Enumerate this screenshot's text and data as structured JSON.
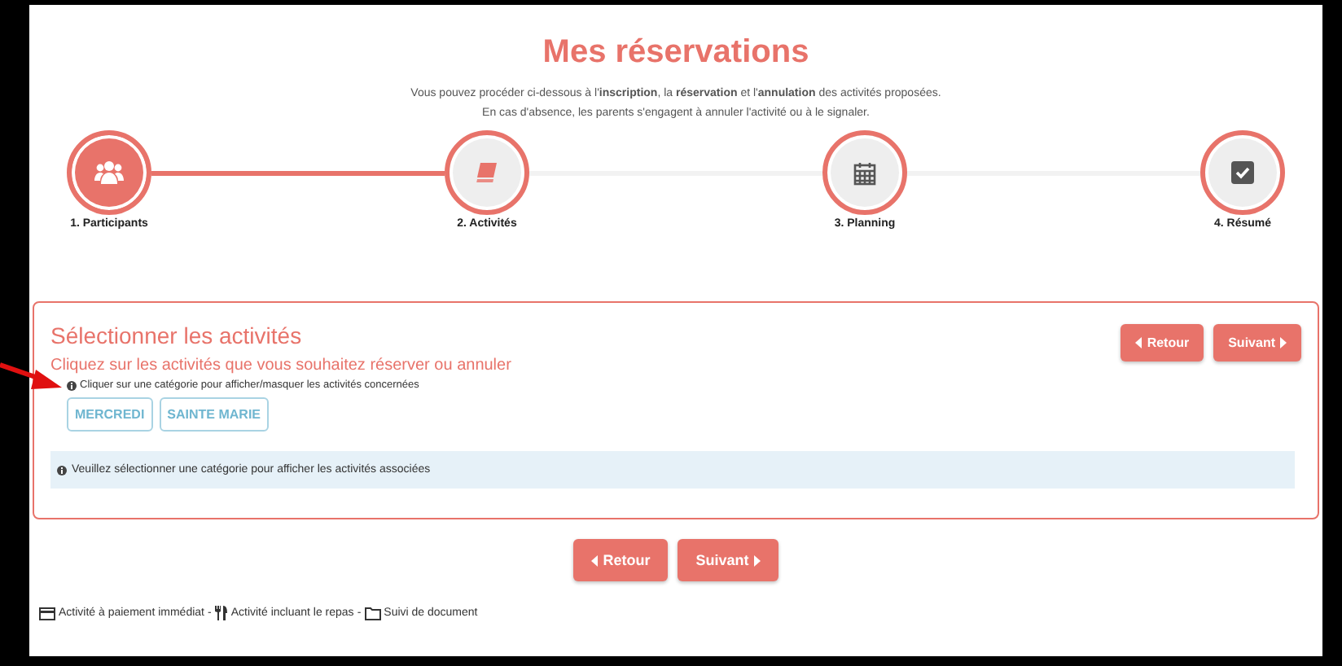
{
  "page": {
    "title": "Mes réservations",
    "intro": [
      "Vous pouvez procéder ci-dessous à l'**inscription**, la **réservation** et l'**annulation** des activités proposées.",
      "En cas d'absence, les parents s'engagent à annuler l'activité ou à le signaler."
    ]
  },
  "steps": [
    {
      "label": "1. Participants",
      "completed": true,
      "selected": false
    },
    {
      "label": "2. Activités",
      "completed": false,
      "selected": true
    },
    {
      "label": "3. Planning",
      "completed": false,
      "selected": false
    },
    {
      "label": "4. Résumé",
      "completed": false,
      "selected": false
    }
  ],
  "panel": {
    "title": "Sélectionner les activités",
    "subtitle": "Cliquez sur les activités que vous souhaitez réserver ou annuler",
    "hint": "Cliquer sur une catégorie pour afficher/masquer les activités concernées",
    "buttons": [
      "Retour",
      "Suivant"
    ],
    "categories": [
      {
        "label": "MERCREDI",
        "selected": false
      },
      {
        "label": "SAINTE MARIE",
        "selected": false
      }
    ],
    "info": "Veuillez sélectionner une catégorie pour afficher les activités associées"
  },
  "buttons": [
    "Retour",
    "Suivant"
  ],
  "legend": [
    {
      "kind": "card",
      "label": "Activité à paiement immédiat"
    },
    {
      "kind": "meal",
      "label": "Activité incluant le repas"
    },
    {
      "kind": "folder",
      "label": "Suivi de document"
    }
  ],
  "legend_separator": " - "
}
